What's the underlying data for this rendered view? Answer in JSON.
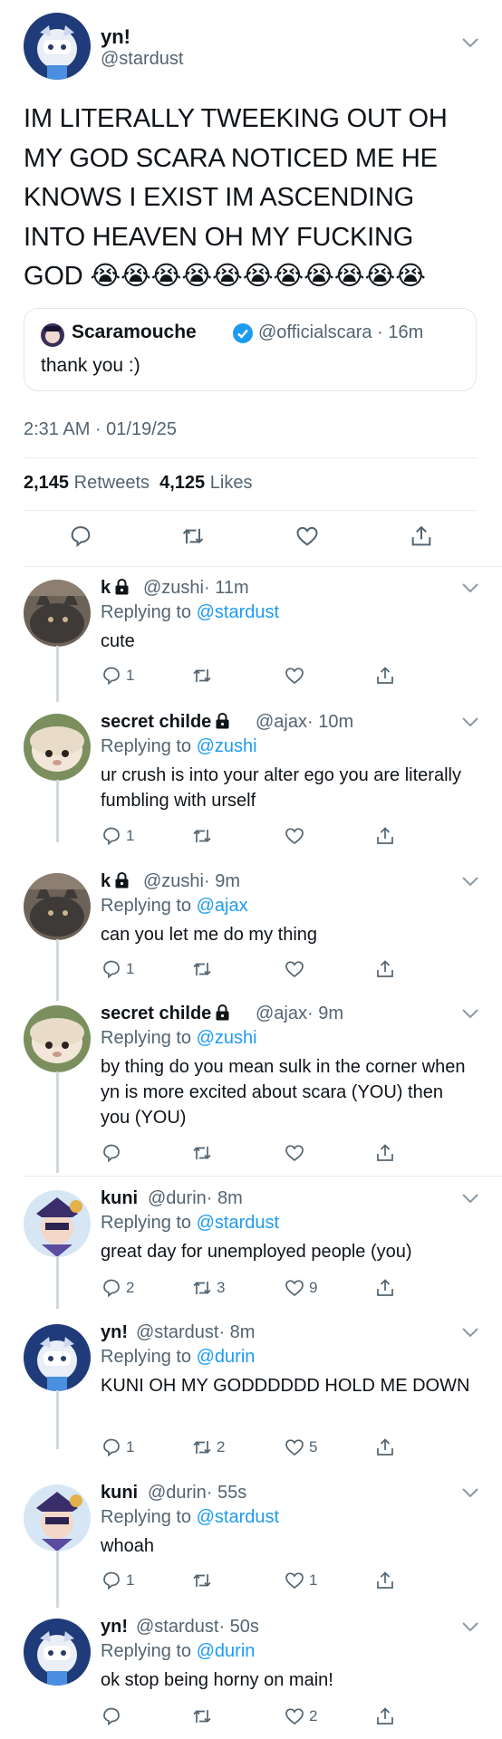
{
  "main": {
    "name": "yn!",
    "handle": "@stardust",
    "text": "IM LITERALLY TWEEKING OUT OH MY GOD SCARA NOTICED ME HE KNOWS I EXIST IM ASCENDING INTO HEAVEN OH MY FUCKING GOD 😭😭😭😭😭😭😭😭😭😭😭",
    "quote": {
      "name": "Scaramouche",
      "handle": "@officialscara",
      "time": "· 16m",
      "text": "thank you :)"
    },
    "timestamp": "2:31 AM · 01/19/25",
    "retweets_count": "2,145",
    "retweets_label": "Retweets",
    "likes_count": "4,125",
    "likes_label": "Likes"
  },
  "replies": [
    {
      "name": "k",
      "locked": true,
      "handle": "@zushi",
      "time": "· 11m",
      "replying_label": "Replying to",
      "replying_to": "@stardust",
      "text": "cute",
      "reply_count": "1",
      "retweet_count": "",
      "like_count": ""
    },
    {
      "name": "secret childe",
      "locked": true,
      "handle": "@ajax",
      "time": "· 10m",
      "replying_label": "Replying to",
      "replying_to": "@zushi",
      "text": "ur crush is into your alter ego you are literally fumbling with urself",
      "reply_count": "1",
      "retweet_count": "",
      "like_count": ""
    },
    {
      "name": "k",
      "locked": true,
      "handle": "@zushi",
      "time": "· 9m",
      "replying_label": "Replying to",
      "replying_to": "@ajax",
      "text": "can you let me do my thing",
      "reply_count": "1",
      "retweet_count": "",
      "like_count": ""
    },
    {
      "name": "secret childe",
      "locked": true,
      "handle": "@ajax",
      "time": "· 9m",
      "replying_label": "Replying to",
      "replying_to": "@zushi",
      "text": "by thing do you mean sulk in the corner when yn is more excited about scara (YOU) then you (YOU)",
      "reply_count": "",
      "retweet_count": "",
      "like_count": ""
    },
    {
      "name": "kuni",
      "locked": false,
      "handle": "@durin",
      "time": "· 8m",
      "replying_label": "Replying to",
      "replying_to": "@stardust",
      "text": "great day for unemployed people (you)",
      "reply_count": "2",
      "retweet_count": "3",
      "like_count": "9"
    },
    {
      "name": "yn!",
      "locked": false,
      "handle": "@stardust",
      "time": "· 8m",
      "replying_label": "Replying to",
      "replying_to": "@durin",
      "text": "KUNI OH MY GODDDDDD HOLD ME DOWN",
      "reply_count": "1",
      "retweet_count": "2",
      "like_count": "5"
    },
    {
      "name": "kuni",
      "locked": false,
      "handle": "@durin",
      "time": "· 55s",
      "replying_label": "Replying to",
      "replying_to": "@stardust",
      "text": "whoah",
      "reply_count": "1",
      "retweet_count": "",
      "like_count": "1"
    },
    {
      "name": "yn!",
      "locked": false,
      "handle": "@stardust",
      "time": "· 50s",
      "replying_label": "Replying to",
      "replying_to": "@durin",
      "text": "ok stop being horny on main!",
      "reply_count": "",
      "retweet_count": "",
      "like_count": "2"
    }
  ],
  "colors": {
    "link": "#1d9bf0",
    "muted": "#536471",
    "verified": "#1d9bf0",
    "divider": "#e6ecf0"
  },
  "icons": [
    "chevron-down-icon",
    "reply-icon",
    "retweet-icon",
    "like-icon",
    "share-icon",
    "lock-icon",
    "verified-badge-icon"
  ]
}
